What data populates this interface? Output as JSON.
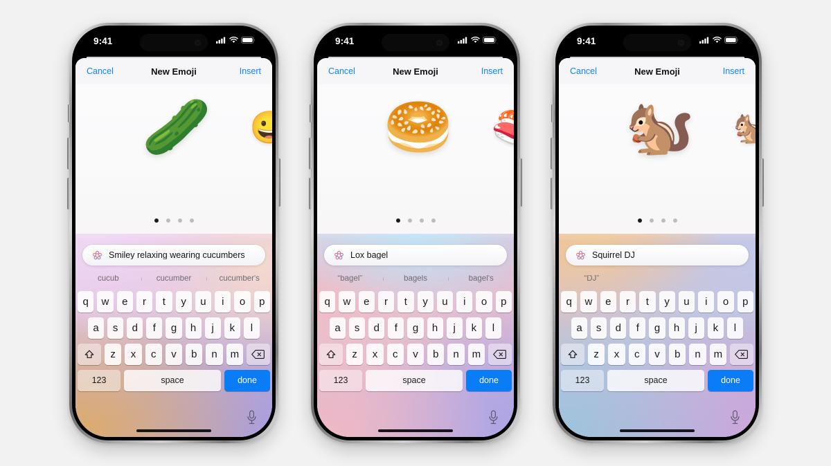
{
  "background_color": "#f2f2f3",
  "accent_color": "#0a84ff",
  "done_key_color": "#0a7cf6",
  "status_bar": {
    "time": "9:41",
    "icons": [
      "cellular-signal-icon",
      "wifi-icon",
      "battery-icon"
    ]
  },
  "navbar": {
    "cancel_label": "Cancel",
    "title": "New Emoji",
    "insert_label": "Insert"
  },
  "keyboard": {
    "row1": [
      "q",
      "w",
      "e",
      "r",
      "t",
      "y",
      "u",
      "i",
      "o",
      "p"
    ],
    "row2": [
      "a",
      "s",
      "d",
      "f",
      "g",
      "h",
      "j",
      "k",
      "l"
    ],
    "row3": [
      "z",
      "x",
      "c",
      "v",
      "b",
      "n",
      "m"
    ],
    "shift_key": "shift-key-icon",
    "backspace_key": "backspace-key-icon",
    "numbers_label": "123",
    "space_label": "space",
    "done_label": "done",
    "mic_icon": "microphone-icon"
  },
  "page_dots": {
    "total": 4,
    "active_index": 0
  },
  "phones": [
    {
      "id": "phone-cucumber",
      "prompt": "Smiley relaxing wearing cucumbers",
      "emoji_main": "🥒",
      "emoji_next": "😀",
      "predictions": [
        "cucub",
        "cucumber",
        "cucumber's"
      ],
      "gradient_class": "g1"
    },
    {
      "id": "phone-bagel",
      "prompt": "Lox bagel",
      "emoji_main": "🥯",
      "emoji_next": "🍣",
      "predictions": [
        "“bagel”",
        "bagels",
        "bagel's"
      ],
      "gradient_class": "g2"
    },
    {
      "id": "phone-squirrel",
      "prompt": "Squirrel DJ",
      "emoji_main": "🐿️",
      "emoji_next": "🐿️",
      "predictions": [
        "“DJ”",
        "",
        ""
      ],
      "gradient_class": "g3"
    }
  ]
}
